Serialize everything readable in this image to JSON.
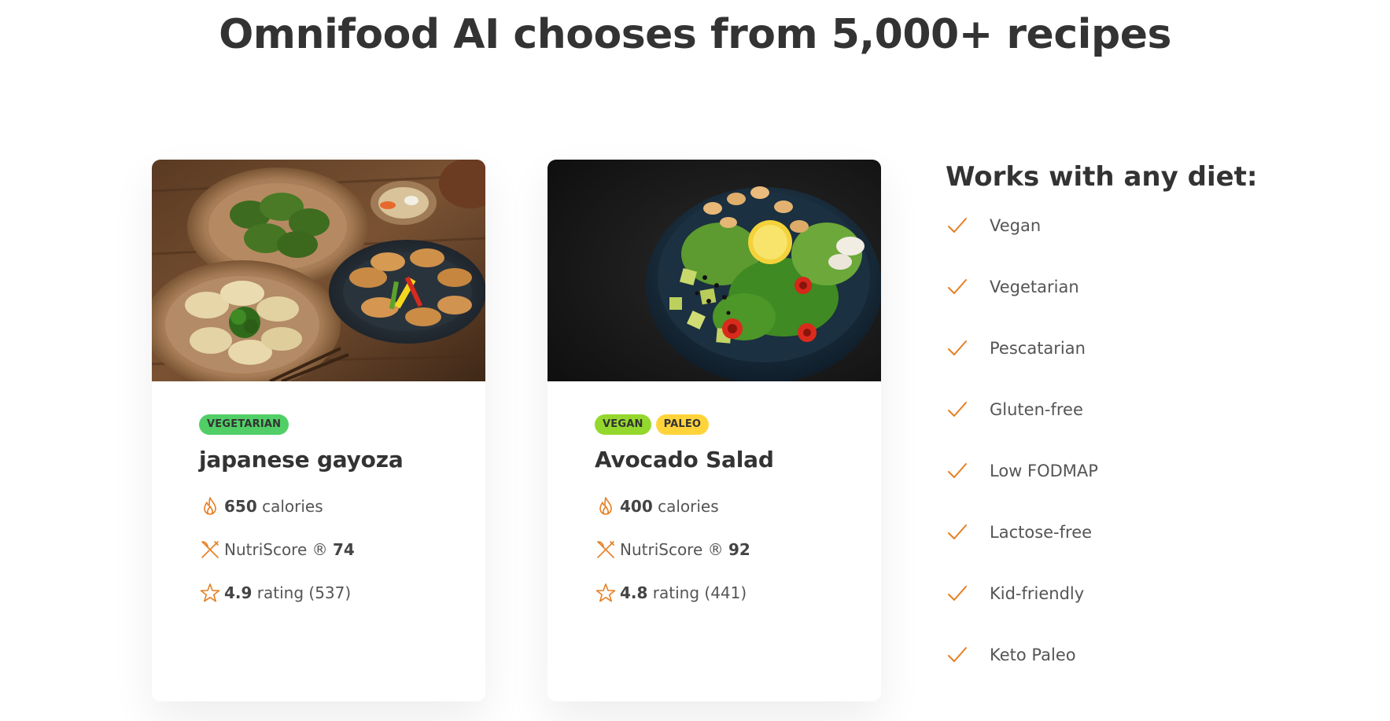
{
  "page": {
    "title": "Omnifood AI chooses from 5,000+ recipes"
  },
  "colors": {
    "accent": "#e67e22",
    "text": "#333333",
    "tag_vegetarian": "#51cf66",
    "tag_vegan": "#94d82d",
    "tag_paleo": "#ffd43b"
  },
  "meals": [
    {
      "tags": [
        "Vegetarian"
      ],
      "title": "japanese gayoza",
      "calories_value": "650",
      "calories_label": "calories",
      "nutri_label": "NutriScore ®",
      "nutri_value": "74",
      "rating_value": "4.9",
      "rating_label": "rating (537)",
      "icons": [
        "flame-icon",
        "restaurant-icon",
        "star-icon"
      ]
    },
    {
      "tags": [
        "Vegan",
        "Paleo"
      ],
      "title": "Avocado Salad",
      "calories_value": "400",
      "calories_label": "calories",
      "nutri_label": "NutriScore ®",
      "nutri_value": "92",
      "rating_value": "4.8",
      "rating_label": "rating (441)",
      "icons": [
        "flame-icon",
        "restaurant-icon",
        "star-icon"
      ]
    }
  ],
  "diets": {
    "title": "Works with any diet:",
    "items": [
      "Vegan",
      "Vegetarian",
      "Pescatarian",
      "Gluten-free",
      "Low FODMAP",
      "Lactose-free",
      "Kid-friendly",
      "Keto Paleo"
    ],
    "icon": "checkmark-icon"
  }
}
